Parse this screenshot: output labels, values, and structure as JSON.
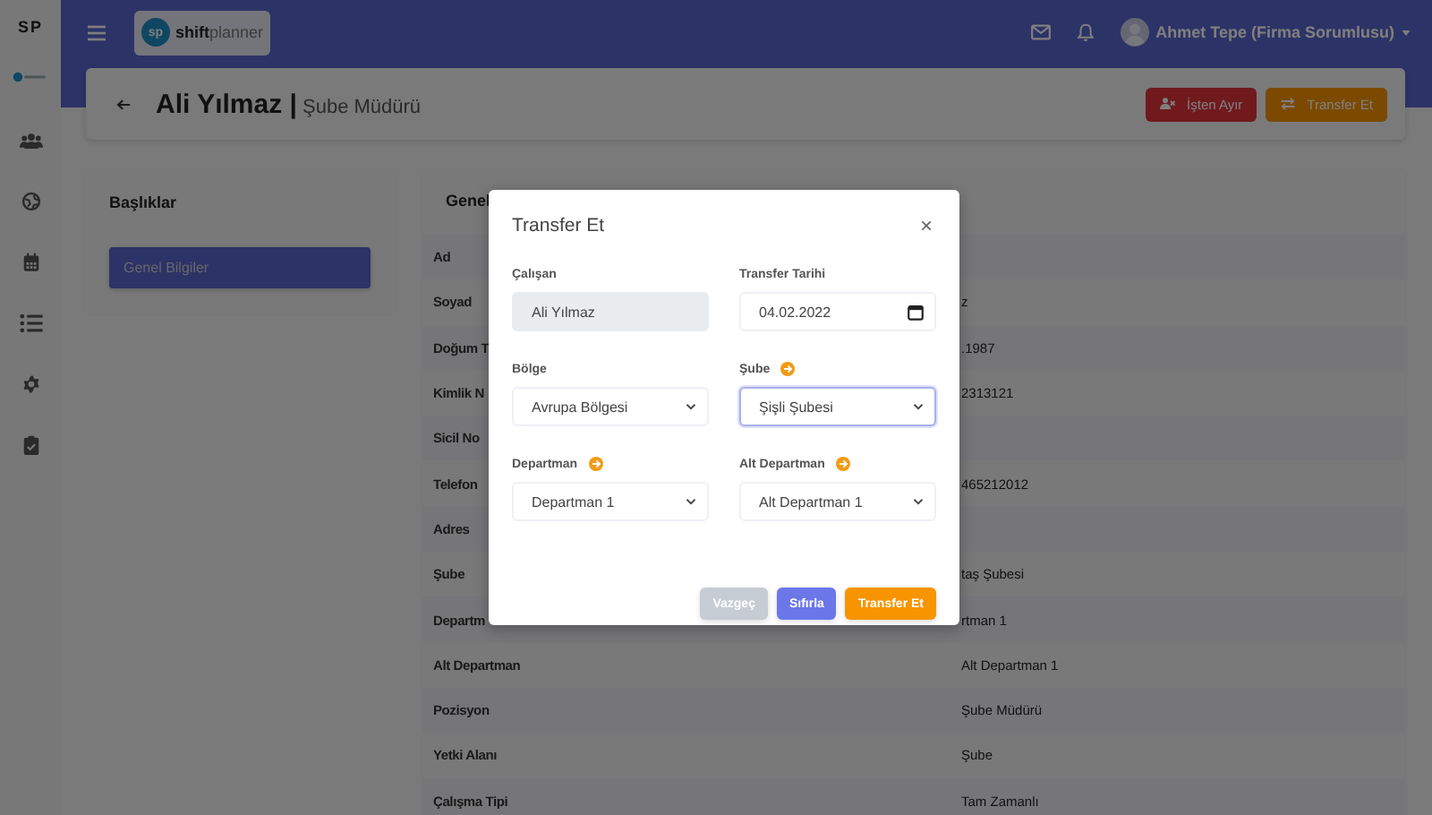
{
  "sidebar": {
    "brand": "SP"
  },
  "topbar": {
    "logo_mark": "sp",
    "logo_text": "**shift**planner",
    "user": "Ahmet Tepe (Firma Sorumlusu)"
  },
  "header": {
    "title": "**Ali Yılmaz |** Şube Müdürü",
    "buttons": [
      {
        "label": "İşten Ayır",
        "kind": "danger"
      },
      {
        "label": "Transfer Et",
        "kind": "warning"
      }
    ]
  },
  "sections": {
    "title": "Başlıklar",
    "items": [
      {
        "label": "Genel Bilgiler",
        "selected": true
      }
    ]
  },
  "details": {
    "title": "Genel",
    "rows": [
      {
        "label": "Ad"
      },
      {
        "label": "Soyad",
        "value": "z"
      },
      {
        "label": "Doğum T",
        "value": ".1987"
      },
      {
        "label": "Kimlik N",
        "value": "2313121"
      },
      {
        "label": "Sicil No"
      },
      {
        "label": "Telefon",
        "value": "465212012"
      },
      {
        "label": "Adres"
      },
      {
        "label": "Şube",
        "value": "taş Şubesi"
      },
      {
        "label": "Departm",
        "value": "rtman 1"
      },
      {
        "label": "Alt Departman",
        "value": "Alt Departman 1"
      },
      {
        "label": "Pozisyon",
        "value": "Şube Müdürü"
      },
      {
        "label": "Yetki Alanı",
        "value": "Şube"
      },
      {
        "label": "Çalışma Tipi",
        "value": "Tam Zamanlı"
      }
    ]
  },
  "modal": {
    "title": "Transfer Et",
    "close": "×",
    "fields": [
      {
        "label": "Çalışan",
        "kind": "text",
        "value": "Ali Yılmaz",
        "disabled": true,
        "focused": false,
        "add": false
      },
      {
        "label": "Transfer Tarihi",
        "kind": "date",
        "value": "04.02.2022",
        "disabled": false,
        "focused": false,
        "add": false
      },
      {
        "label": "Bölge",
        "kind": "select",
        "value": "Avrupa Bölgesi",
        "disabled": false,
        "focused": false,
        "add": false
      },
      {
        "label": "Şube",
        "kind": "select",
        "value": "Şişli Şubesi",
        "disabled": false,
        "focused": true,
        "add": true
      },
      {
        "label": "Departman",
        "kind": "select",
        "value": "Departman 1",
        "disabled": false,
        "focused": false,
        "add": true
      },
      {
        "label": "Alt Departman",
        "kind": "select",
        "value": "Alt Departman 1",
        "disabled": false,
        "focused": false,
        "add": true
      }
    ],
    "buttons": [
      {
        "label": "Vazgeç",
        "kind": "secondary"
      },
      {
        "label": "Sıfırla",
        "kind": "primary"
      },
      {
        "label": "Transfer Et",
        "kind": "warning"
      }
    ]
  }
}
